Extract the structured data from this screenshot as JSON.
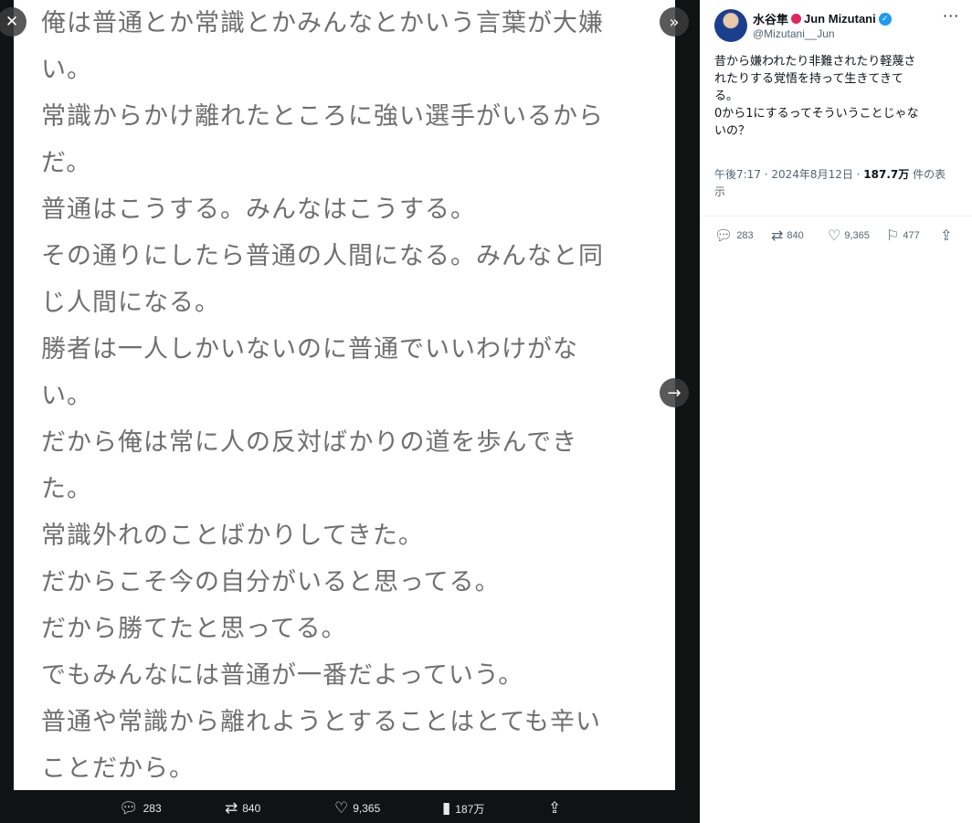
{
  "viewer": {
    "image_lines": [
      "俺は普通とか常識とかみんなとかいう言葉が大嫌",
      "い。",
      "常識からかけ離れたところに強い選手がいるから",
      "だ。",
      "普通はこうする。みんなはこうする。",
      "その通りにしたら普通の人間になる。みんなと同",
      "じ人間になる。",
      "勝者は一人しかいないのに普通でいいわけがな",
      "い。",
      "だから俺は常に人の反対ばかりの道を歩んでき",
      "た。",
      "常識外れのことばかりしてきた。",
      "だからこそ今の自分がいると思ってる。",
      "だから勝てたと思ってる。",
      "でもみんなには普通が一番だよっていう。",
      "普通や常識から離れようとすることはとても辛い",
      "ことだから。"
    ],
    "actions": {
      "reply_count": "283",
      "retweet_count": "840",
      "like_count": "9,365",
      "views_count": "187万"
    },
    "icons": {
      "close": "close-icon",
      "expand": "expand-icon",
      "next": "arrow-right-icon"
    }
  },
  "tweet": {
    "display_name": "水谷隼",
    "display_name_en": "Jun Mizutani",
    "handle": "@Mizutani__Jun",
    "text_lines": [
      "昔から嫌われたり非難されたり軽蔑さ",
      "れたりする覚悟を持って生きてきて",
      "る。",
      "0から1にするってそういうことじゃな",
      "いの？"
    ],
    "time": "午後7:17 · 2024年8月12日 · ",
    "views": "187.7万",
    "views_suffix": " 件の表",
    "views_suffix2": "示",
    "actions": {
      "reply_count": "283",
      "retweet_count": "840",
      "like_count": "9,365",
      "bookmark_count": "477"
    },
    "colors": {
      "verified": "#1d9bf0",
      "text": "#0f1419",
      "secondary": "#536471"
    }
  }
}
